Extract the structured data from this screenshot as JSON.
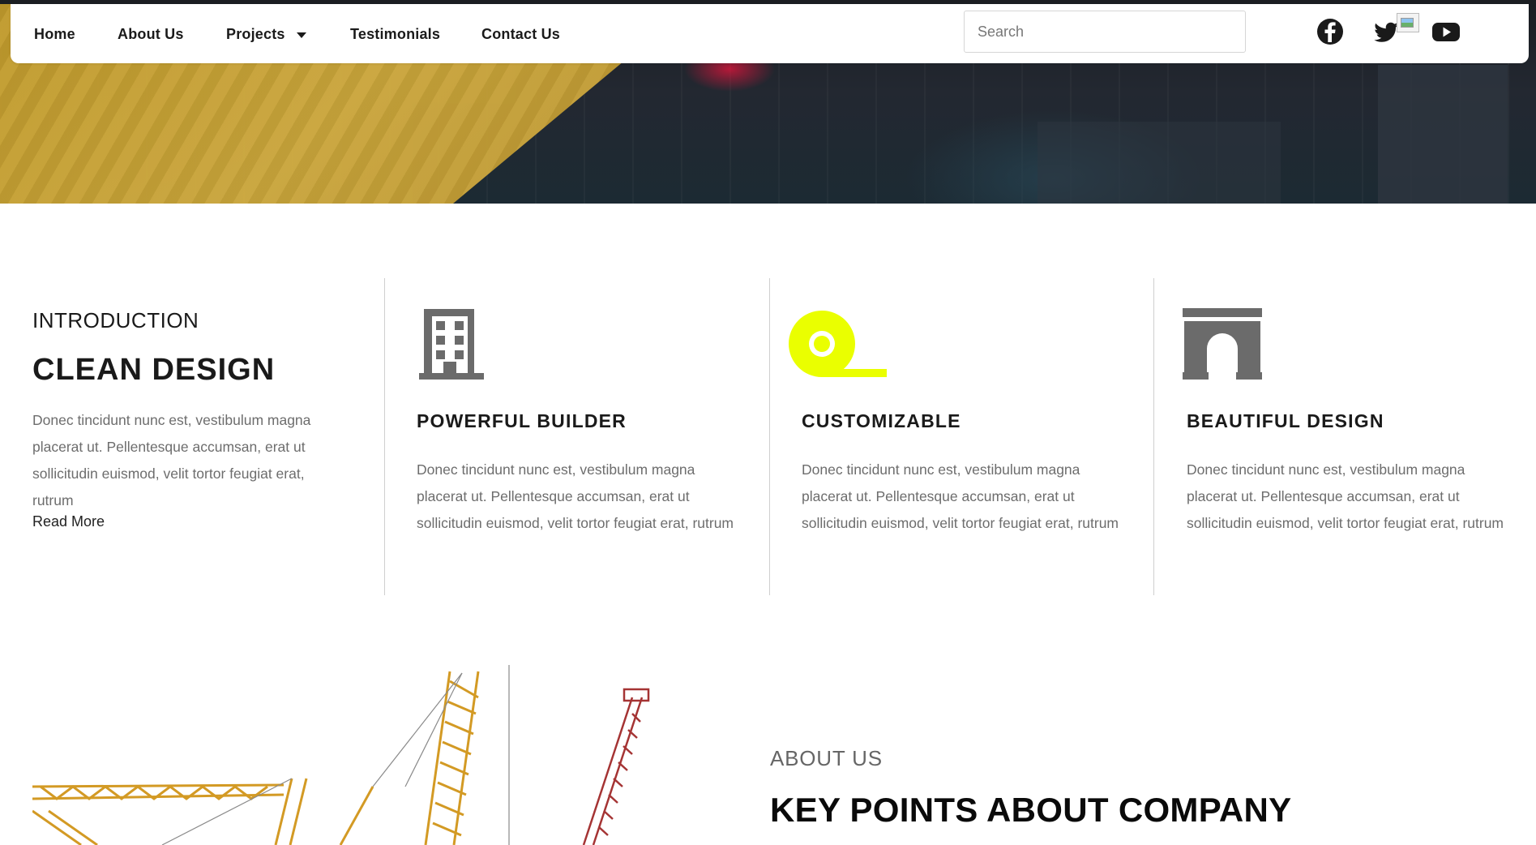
{
  "nav": {
    "items": [
      {
        "label": "Home"
      },
      {
        "label": "About Us"
      },
      {
        "label": "Projects",
        "has_dropdown": true
      },
      {
        "label": "Testimonials"
      },
      {
        "label": "Contact Us"
      }
    ],
    "search_placeholder": "Search",
    "social": [
      "facebook-icon",
      "twitter-icon",
      "youtube-icon"
    ]
  },
  "colors": {
    "hero_accent": "#c9a232",
    "customizable_icon": "#eaff00",
    "icon_gray": "#6b6b6b",
    "heading": "#1a1a1a",
    "body_text": "#6d6d6d"
  },
  "intro": {
    "label": "INTRODUCTION",
    "title": "CLEAN DESIGN",
    "text": "Donec tincidunt nunc est, vestibulum magna placerat ut. Pellentesque accumsan, erat ut sollicitudin euismod, velit tortor feugiat erat, rutrum",
    "read_more": "Read More"
  },
  "features": [
    {
      "icon": "building-icon",
      "title": "POWERFUL BUILDER",
      "text": "Donec tincidunt nunc est, vestibulum magna placerat ut. Pellentesque accumsan, erat ut sollicitudin euismod, velit tortor feugiat erat, rutrum"
    },
    {
      "icon": "tape-roll-icon",
      "title": "CUSTOMIZABLE",
      "text": "Donec tincidunt nunc est, vestibulum magna placerat ut. Pellentesque accumsan, erat ut sollicitudin euismod, velit tortor feugiat erat, rutrum"
    },
    {
      "icon": "arch-icon",
      "title": "BEAUTIFUL DESIGN",
      "text": "Donec tincidunt nunc est, vestibulum magna placerat ut. Pellentesque accumsan, erat ut sollicitudin euismod, velit tortor feugiat erat, rutrum"
    }
  ],
  "about": {
    "label": "ABOUT US",
    "title": "KEY POINTS ABOUT COMPANY"
  }
}
